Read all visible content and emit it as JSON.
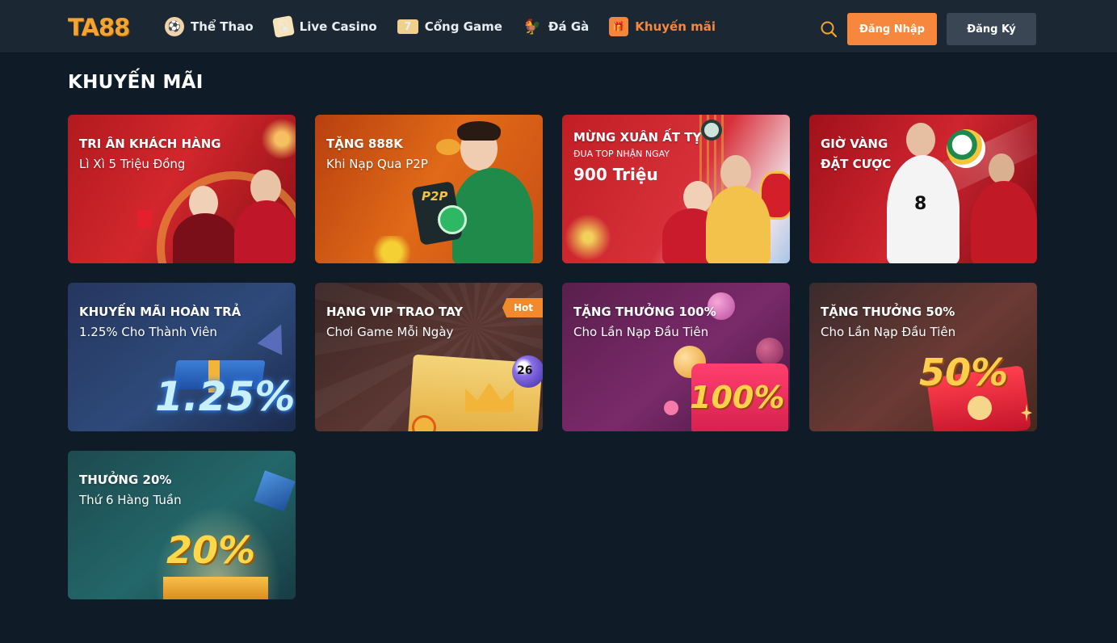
{
  "brand": {
    "logo_text": "TA88"
  },
  "nav": {
    "items": [
      {
        "label": "Thể Thao",
        "icon": "sport-icon"
      },
      {
        "label": "Live Casino",
        "icon": "casino-card-icon"
      },
      {
        "label": "Cổng Game",
        "icon": "slot-game-icon"
      },
      {
        "label": "Đá Gà",
        "icon": "rooster-icon"
      },
      {
        "label": "Khuyến mãi",
        "icon": "gift-icon"
      }
    ],
    "active_index": 4
  },
  "header": {
    "login_label": "Đăng Nhập",
    "register_label": "Đăng Ký"
  },
  "colors": {
    "accent": "#f7873c",
    "background": "#0f1c27",
    "header_bg": "#1b2733",
    "register_btn": "#3a4654"
  },
  "page": {
    "title": "KHUYẾN MÃI"
  },
  "promotions": [
    {
      "line1": "TRI ÂN KHÁCH HÀNG",
      "line2": "Lì Xì 5 Triệu Đồng"
    },
    {
      "line1": "TẶNG 888K",
      "line2": "Khi Nạp Qua P2P",
      "art_text": "P2P"
    },
    {
      "line1": "MỪNG XUÂN ẤT TỴ",
      "line2": "ĐUA TOP NHẬN NGAY",
      "line3": "900 Triệu"
    },
    {
      "line1": "GIỜ VÀNG",
      "line2": "ĐẶT CƯỢC",
      "art_text": "8"
    },
    {
      "line1": "KHUYẾN MÃI HOÀN TRẢ",
      "line2": "1.25% Cho Thành Viên",
      "art_text": "1.25%"
    },
    {
      "line1": "HẠNG VIP TRAO TAY",
      "line2": "Chơi Game Mỗi Ngày",
      "badge": "Hot",
      "art_text": "26"
    },
    {
      "line1": "TẶNG THƯỞNG 100%",
      "line2": "Cho Lần Nạp Đầu Tiên",
      "art_text": "100%"
    },
    {
      "line1": "TẶNG THƯỞNG 50%",
      "line2": "Cho Lần Nạp Đầu Tiên",
      "art_text": "50%"
    },
    {
      "line1": "THƯỞNG 20%",
      "line2": "Thứ 6 Hàng Tuần",
      "art_text": "20%"
    }
  ]
}
